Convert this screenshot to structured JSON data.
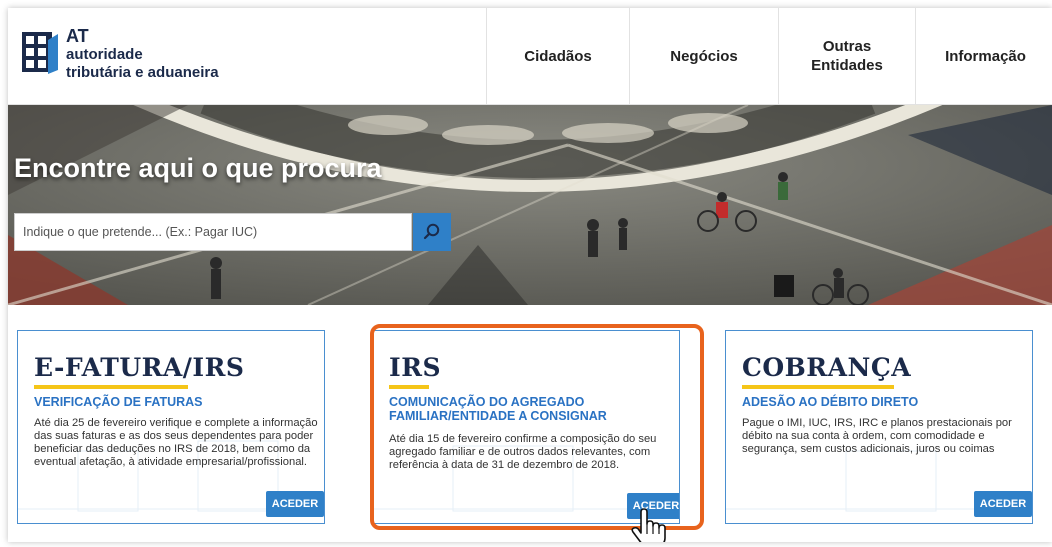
{
  "brand": {
    "short": "AT",
    "line1": "autoridade",
    "line2": "tributária e aduaneira",
    "colors": {
      "navy": "#1b2a4a",
      "blue": "#2f80c8",
      "accent": "#e8631d",
      "gold": "#f5c518"
    }
  },
  "nav": [
    {
      "label": "Cidadãos"
    },
    {
      "label": "Negócios"
    },
    {
      "label_line1": "Outras",
      "label_line2": "Entidades"
    },
    {
      "label": "Informação"
    }
  ],
  "hero": {
    "title": "Encontre aqui o que procura",
    "search_placeholder": "Indique o que pretende... (Ex.: Pagar IUC)",
    "search_icon": "search-icon"
  },
  "cards": [
    {
      "title": "E-FATURA/IRS",
      "subtitle": "VERIFICAÇÃO DE FATURAS",
      "text": "Até dia 25 de fevereiro verifique e complete a informação das suas faturas e as dos seus dependentes para poder beneficiar das deduções no IRS de 2018, bem como da eventual afetação, à atividade empresarial/profissional.",
      "button": "ACEDER"
    },
    {
      "title": "IRS",
      "subtitle": "COMUNICAÇÃO DO AGREGADO FAMILIAR/ENTIDADE A CONSIGNAR",
      "text": "Até dia 15 de fevereiro confirme a composição do seu agregado familiar e de outros dados relevantes, com referência à data de 31 de dezembro de 2018.",
      "button": "ACEDER"
    },
    {
      "title": "COBRANÇA",
      "subtitle": "ADESÃO AO DÉBITO DIRETO",
      "text": "Pague o IMI, IUC, IRS, IRC e planos prestacionais por débito na sua conta à ordem, com comodidade e segurança, sem custos adicionais, juros ou coimas",
      "button": "ACEDER"
    }
  ]
}
